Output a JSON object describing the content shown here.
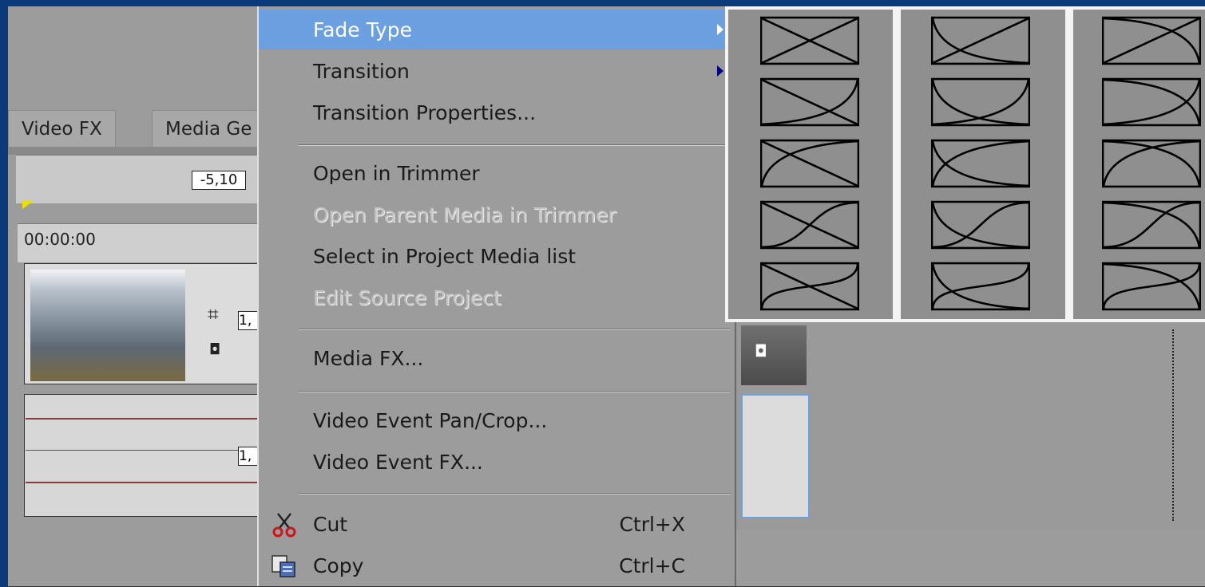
{
  "tabs": {
    "video_fx": "Video FX",
    "media_generators": "Media Ge"
  },
  "timeline": {
    "time_display": "00:00:00",
    "marker_value": "-5,10",
    "event_label_1": "1,",
    "event_label_2": "1,"
  },
  "menu": {
    "items": [
      {
        "id": "fade-type",
        "label": "Fade Type",
        "highlighted": true,
        "submenu": true,
        "disabled": false
      },
      {
        "id": "transition",
        "label": "Transition",
        "highlighted": false,
        "submenu": true,
        "disabled": false
      },
      {
        "id": "transition-properties",
        "label": "Transition Properties...",
        "highlighted": false,
        "submenu": false,
        "disabled": false
      },
      {
        "id": "open-in-trimmer",
        "label": "Open in Trimmer",
        "highlighted": false,
        "submenu": false,
        "disabled": false
      },
      {
        "id": "open-parent-media",
        "label": "Open Parent Media in Trimmer",
        "highlighted": false,
        "submenu": false,
        "disabled": true
      },
      {
        "id": "select-in-project-media",
        "label": "Select in Project Media list",
        "highlighted": false,
        "submenu": false,
        "disabled": false
      },
      {
        "id": "edit-source-project",
        "label": "Edit Source Project",
        "highlighted": false,
        "submenu": false,
        "disabled": true
      },
      {
        "id": "media-fx",
        "label": "Media FX...",
        "highlighted": false,
        "submenu": false,
        "disabled": false
      },
      {
        "id": "pan-crop",
        "label": "Video Event Pan/Crop...",
        "highlighted": false,
        "submenu": false,
        "disabled": false
      },
      {
        "id": "video-event-fx",
        "label": "Video Event FX...",
        "highlighted": false,
        "submenu": false,
        "disabled": false
      },
      {
        "id": "cut",
        "label": "Cut",
        "shortcut": "Ctrl+X",
        "icon": "scissors-icon",
        "highlighted": false,
        "submenu": false,
        "disabled": false
      },
      {
        "id": "copy",
        "label": "Copy",
        "shortcut": "Ctrl+C",
        "icon": "copy-icon",
        "highlighted": false,
        "submenu": false,
        "disabled": false
      }
    ]
  },
  "fade_types": {
    "columns": [
      {
        "name": "fade-column-1",
        "curves": [
          "linear-in-linear-out",
          "linear-in-fast-out",
          "slow-in-linear-out",
          "linear-in-smooth-out",
          "linear-in-sharp-out"
        ]
      },
      {
        "name": "fade-column-2",
        "curves": [
          "fast-in-linear-out",
          "fast-in-fast-out",
          "fast-in-slow-out",
          "fast-in-smooth-out",
          "fast-in-sharp-out"
        ]
      },
      {
        "name": "fade-column-3",
        "curves": [
          "slow-in-linear-out",
          "slow-in-fast-out",
          "slow-in-slow-out",
          "slow-in-smooth-out",
          "slow-in-sharp-out"
        ]
      }
    ]
  },
  "colors": {
    "highlight": "#6b9fe0",
    "menu_bg": "#9c9c9c",
    "desktop": "#0a3a7a"
  }
}
